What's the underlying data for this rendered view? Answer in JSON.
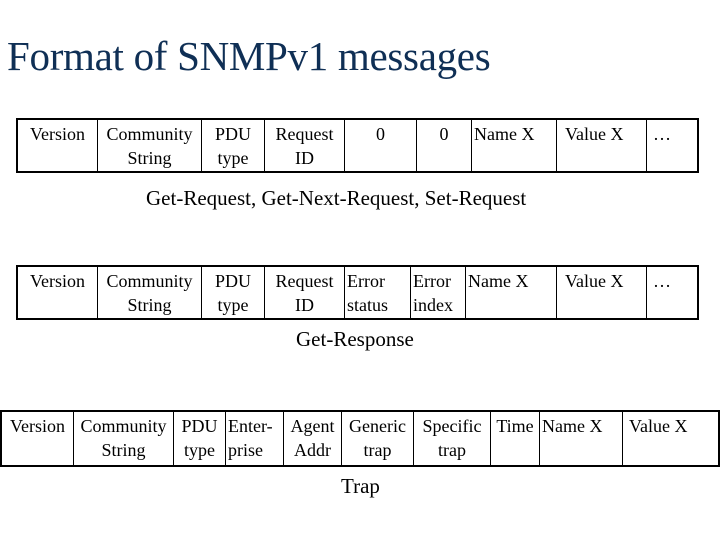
{
  "title": "Format of SNMPv1 messages",
  "formats": [
    {
      "caption": "Get-Request, Get-Next-Request, Set-Request",
      "fields": [
        {
          "line1": "Version",
          "line2": ""
        },
        {
          "line1": "Community",
          "line2": "String"
        },
        {
          "line1": "PDU",
          "line2": "type"
        },
        {
          "line1": "Request",
          "line2": "ID"
        },
        {
          "line1": "0",
          "line2": ""
        },
        {
          "line1": "0",
          "line2": ""
        },
        {
          "line1": "Name X",
          "line2": ""
        },
        {
          "line1": "Value X",
          "line2": ""
        },
        {
          "line1": "…",
          "line2": ""
        }
      ]
    },
    {
      "caption": "Get-Response",
      "fields": [
        {
          "line1": "Version",
          "line2": ""
        },
        {
          "line1": "Community",
          "line2": "String"
        },
        {
          "line1": "PDU",
          "line2": "type"
        },
        {
          "line1": "Request",
          "line2": "ID"
        },
        {
          "line1": "Error",
          "line2": "status"
        },
        {
          "line1": "Error",
          "line2": "index"
        },
        {
          "line1": "Name X",
          "line2": ""
        },
        {
          "line1": "Value X",
          "line2": ""
        },
        {
          "line1": "…",
          "line2": ""
        }
      ]
    },
    {
      "caption": "Trap",
      "fields": [
        {
          "line1": "Version",
          "line2": ""
        },
        {
          "line1": "Community",
          "line2": "String"
        },
        {
          "line1": "PDU",
          "line2": "type"
        },
        {
          "line1": "Enter-",
          "line2": "prise"
        },
        {
          "line1": "Agent",
          "line2": "Addr"
        },
        {
          "line1": "Generic",
          "line2": "trap"
        },
        {
          "line1": "Specific",
          "line2": "trap"
        },
        {
          "line1": "Time",
          "line2": ""
        },
        {
          "line1": "Name X",
          "line2": ""
        },
        {
          "line1": "Value X",
          "line2": ""
        }
      ]
    }
  ]
}
